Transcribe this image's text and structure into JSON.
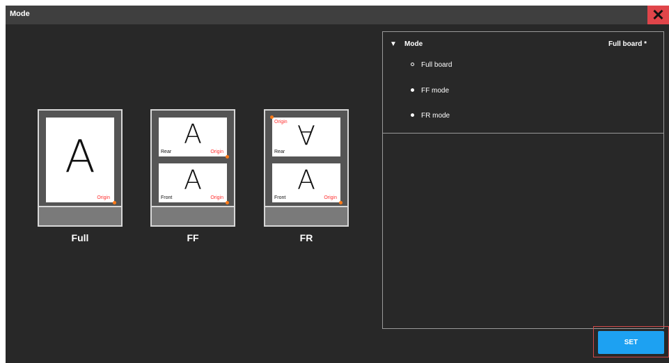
{
  "window": {
    "title": "Mode",
    "close_icon": "close-icon"
  },
  "boards": [
    {
      "label": "Full",
      "letter": "A",
      "origin": "Origin"
    },
    {
      "label": "FF",
      "rear_letter": "A",
      "front_letter": "A",
      "rear": "Rear",
      "front": "Front",
      "origin": "Origin"
    },
    {
      "label": "FR",
      "rear_letter": "A",
      "front_letter": "A",
      "rear": "Rear",
      "front": "Front",
      "origin": "Origin"
    }
  ],
  "settings": {
    "section_title": "Mode",
    "section_value": "Full board *",
    "options": [
      {
        "label": "Full board",
        "selected": true
      },
      {
        "label": "FF mode",
        "selected": false
      },
      {
        "label": "FR mode",
        "selected": false
      }
    ]
  },
  "footer": {
    "set_label": "SET"
  },
  "colors": {
    "accent": "#1da1f2",
    "close": "#e0454a",
    "origin": "#ff3030"
  }
}
